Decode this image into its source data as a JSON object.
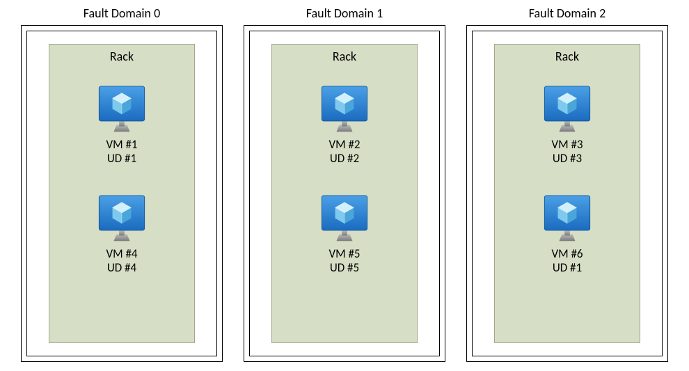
{
  "faultDomains": [
    {
      "title": "Fault Domain 0",
      "rackLabel": "Rack",
      "vms": [
        {
          "vmLabel": "VM #1",
          "udLabel": "UD #1"
        },
        {
          "vmLabel": "VM #4",
          "udLabel": "UD #4"
        }
      ]
    },
    {
      "title": "Fault Domain 1",
      "rackLabel": "Rack",
      "vms": [
        {
          "vmLabel": "VM #2",
          "udLabel": "UD #2"
        },
        {
          "vmLabel": "VM #5",
          "udLabel": "UD #5"
        }
      ]
    },
    {
      "title": "Fault Domain 2",
      "rackLabel": "Rack",
      "vms": [
        {
          "vmLabel": "VM #3",
          "udLabel": "UD #3"
        },
        {
          "vmLabel": "VM #6",
          "udLabel": "UD #1"
        }
      ]
    }
  ],
  "colors": {
    "rackFill": "#d6dec6",
    "rackStroke": "#a0a88a",
    "monitorFill": "#2f8ae0",
    "monitorStroke": "#1b6bbf",
    "cubeLight": "#bde6f7",
    "cubeMid": "#7ec9ee",
    "cubeDark": "#4aa6da",
    "standGrey": "#8b8b8b"
  }
}
